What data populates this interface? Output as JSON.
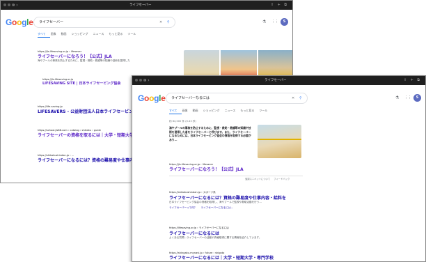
{
  "browser": {
    "address": "ライフセーバー"
  },
  "google": {
    "logo": {
      "G": "G",
      "o1": "o",
      "o2": "o",
      "g": "g",
      "l": "l",
      "e": "e"
    },
    "icons": {
      "flask": "⚗",
      "grid": "⋮⋮"
    }
  },
  "win1": {
    "query": "ライフセーバー",
    "avatar": "S",
    "tabs": [
      "すべて",
      "画像",
      "動画",
      "ショッピング",
      "ニュース",
      "もっと見る",
      "ツール"
    ],
    "results": [
      {
        "url": "https://jls.lifesaving.or.jp › lifesaver",
        "title": "ライフセーバーになろう！【公式】JLA",
        "snippet": "海やプールの事故を防止するために、監視・救助・救護等の知識や技術を習得した"
      },
      {
        "url": "https://jls.lifesaving.or.jp",
        "title": "LIFESAVING SITE | 日本ライフセービング協会"
      },
      {
        "url": "https://life-saving.jp",
        "title": "LIFESAVERS - 公益財団法人日本ライフセービング"
      },
      {
        "url": "https://school.jls88.com › catalog › shikaku › guide",
        "title": "ライフセーバーの資格を取るには｜大学・短期大学"
      },
      {
        "url": "https://shikakushindan.jp › ...",
        "title": "ライフセーバーになるには？資格の難易度や仕事内容"
      }
    ]
  },
  "win2": {
    "query": "ライフセーバーなるには",
    "avatar": "S",
    "tabs": [
      "すべて",
      "画像",
      "動画",
      "ショッピング",
      "ニュース",
      "もっと見る",
      "ツール"
    ],
    "stats": [
      "約 84,000 件",
      "(0.43 秒)"
    ],
    "featured": {
      "text": "海やプールの事故を防止するために、監視・救助・救護等の知識や技術を習得した者をライフセーバーと呼びます。また、ライフセーバーになるためには、日本ライフセービング協会の資格を取得する必要があり…",
      "url": "https://jls.lifesaving.or.jp › lifesaver",
      "title": "ライフセーバーになろう！【公式】JLA",
      "footer": [
        "強調スニペットについて",
        "フィードバック"
      ]
    },
    "results": [
      {
        "url": "https://shikakushindan.jp › スポーツ系",
        "title": "ライフセーバーになるには？資格の難易度や仕事内容・給料を",
        "snippet": "日本ライフセービング協会の資格を取得し、海やプールで監視や救助活動を行う…",
        "links": [
          "ライフセーバーって何？",
          "ライフセーバーになるには…"
        ]
      },
      {
        "url": "https://lifesaving.or.jp › ライフセーバーになるには",
        "title": "ライフセーバーになるには",
        "snippet": "よくある質問…ライフセーバーの活動や資格取得に関する情報を紹介しています。"
      },
      {
        "url": "https://shingaku.mynavi.jp › future › shigoto",
        "title": "ライフセーバーになるには｜大学・短期大学・専門学校"
      }
    ]
  }
}
